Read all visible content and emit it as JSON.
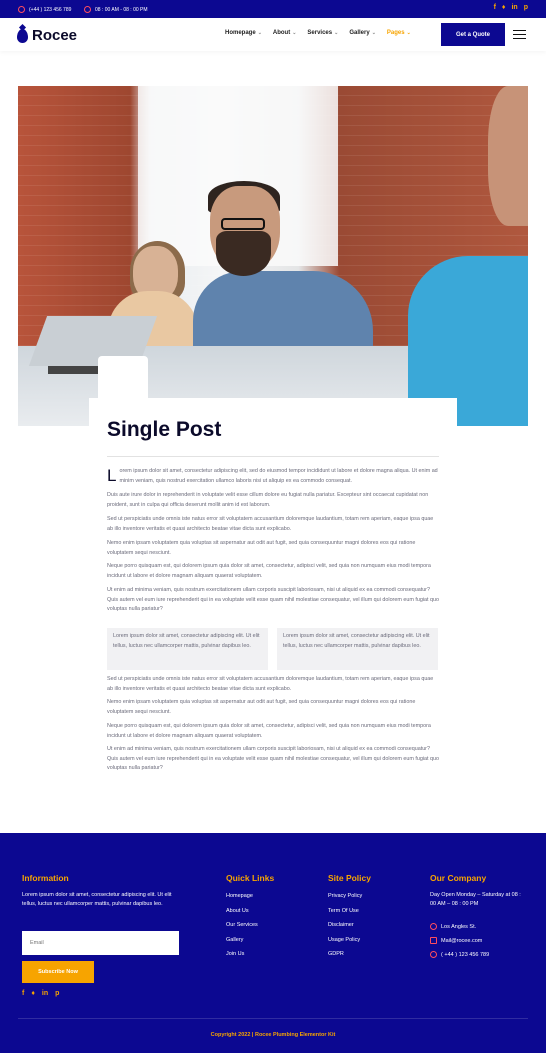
{
  "topbar": {
    "phone": "(+44 ) 123 456 789",
    "hours": "08 : 00 AM - 08 : 00 PM",
    "social_icons": [
      "facebook-icon",
      "twitter-icon",
      "linkedin-icon",
      "pinterest-icon"
    ]
  },
  "header": {
    "logo_text": "Rocee",
    "nav": [
      {
        "label": "Homepage"
      },
      {
        "label": "About"
      },
      {
        "label": "Services"
      },
      {
        "label": "Gallery"
      },
      {
        "label": "Pages"
      }
    ],
    "cta_label": "Get a Quote"
  },
  "post": {
    "title": "Single Post",
    "dropcap": "L",
    "p1": "orem ipsum dolor sit amet, consectetur adipiscing elit, sed do eiusmod tempor incididunt ut labore et dolore magna aliqua. Ut enim ad minim veniam, quis nostrud exercitation ullamco laboris nisi ut aliquip ex ea commodo consequat.",
    "p2": "Duis aute irure dolor in reprehenderit in voluptate velit esse cillum dolore eu fugiat nulla pariatur. Excepteur sint occaecat cupidatat non proident, sunt in culpa qui officia deserunt mollit anim id est laborum.",
    "p3": "Sed ut perspiciatis unde omnis iste natus error sit voluptatem accusantium doloremque laudantium, totam rem aperiam, eaque ipsa quae ab illo inventore veritatis et quasi architecto beatae vitae dicta sunt explicabo.",
    "p4": "Nemo enim ipsam voluptatem quia voluptas sit aspernatur aut odit aut fugit, sed quia consequuntur magni dolores eos qui ratione voluptatem sequi nesciunt.",
    "p5": "Neque porro quisquam est, qui dolorem ipsum quia dolor sit amet, consectetur, adipisci velit, sed quia non numquam eius modi tempora incidunt ut labore et dolore magnam aliquam quaerat voluptatem.",
    "p6": "Ut enim ad minima veniam, quis nostrum exercitationem ullam corporis suscipit laboriosam, nisi ut aliquid ex ea commodi consequatur? Quis autem vel eum iure reprehenderit qui in ea voluptate velit esse quam nihil molestiae consequatur, vel illum qui dolorem eum fugiat quo voluptas nulla pariatur?",
    "box1": "Lorem ipsum dolor sit amet, consectetur adipiscing elit. Ut elit tellus, luctus nec ullamcorper mattis, pulvinar dapibus leo.",
    "box2": "Lorem ipsum dolor sit amet, consectetur adipiscing elit. Ut elit tellus, luctus nec ullamcorper mattis, pulvinar dapibus leo.",
    "p7": "Sed ut perspiciatis unde omnis iste natus error sit voluptatem accusantium doloremque laudantium, totam rem aperiam, eaque ipsa quae ab illo inventore veritatis et quasi architecto beatae vitae dicta sunt explicabo.",
    "p8": "Nemo enim ipsam voluptatem quia voluptas sit aspernatur aut odit aut fugit, sed quia consequuntur magni dolores eos qui ratione voluptatem sequi nesciunt.",
    "p9": "Neque porro quisquam est, qui dolorem ipsum quia dolor sit amet, consectetur, adipisci velit, sed quia non numquam eius modi tempora incidunt ut labore et dolore magnam aliquam quaerat voluptatem.",
    "p10": "Ut enim ad minima veniam, quis nostrum exercitationem ullam corporis suscipit laboriosam, nisi ut aliquid ex ea commodi consequatur? Quis autem vel eum iure reprehenderit qui in ea voluptate velit esse quam nihil molestiae consequatur, vel illum qui dolorem eum fugiat quo voluptas nulla pariatur?"
  },
  "footer": {
    "info_title": "Information",
    "info_text": "Lorem ipsum dolor sit amet, consectetur adipiscing elit. Ut elit tellus, luctus nec ullamcorper mattis, pulvinar dapibus leo.",
    "email_placeholder": "Email",
    "subscribe_label": "Subscribe Now",
    "quick_links_title": "Quick Links",
    "quick_links": [
      "Homepage",
      "About Us",
      "Our Services",
      "Gallery",
      "Join Us"
    ],
    "site_policy_title": "Site Policy",
    "site_policy": [
      "Privacy Policy",
      "Term Of Use",
      "Disclaimer",
      "Usage Policy",
      "GDPR"
    ],
    "company_title": "Our Company",
    "company_hours": "Day Open Monday – Saturday at 08 : 00 AM – 08 : 00 PM",
    "address": "Los Angles St.",
    "email": "Mail@rocee.com",
    "phone": "( +44 ) 123 456 789",
    "copyright": "Copyright 2022 | Rocee Plumbing Elementor Kit"
  },
  "colors": {
    "brand_blue": "#0c0891",
    "accent_orange": "#f7a400"
  }
}
